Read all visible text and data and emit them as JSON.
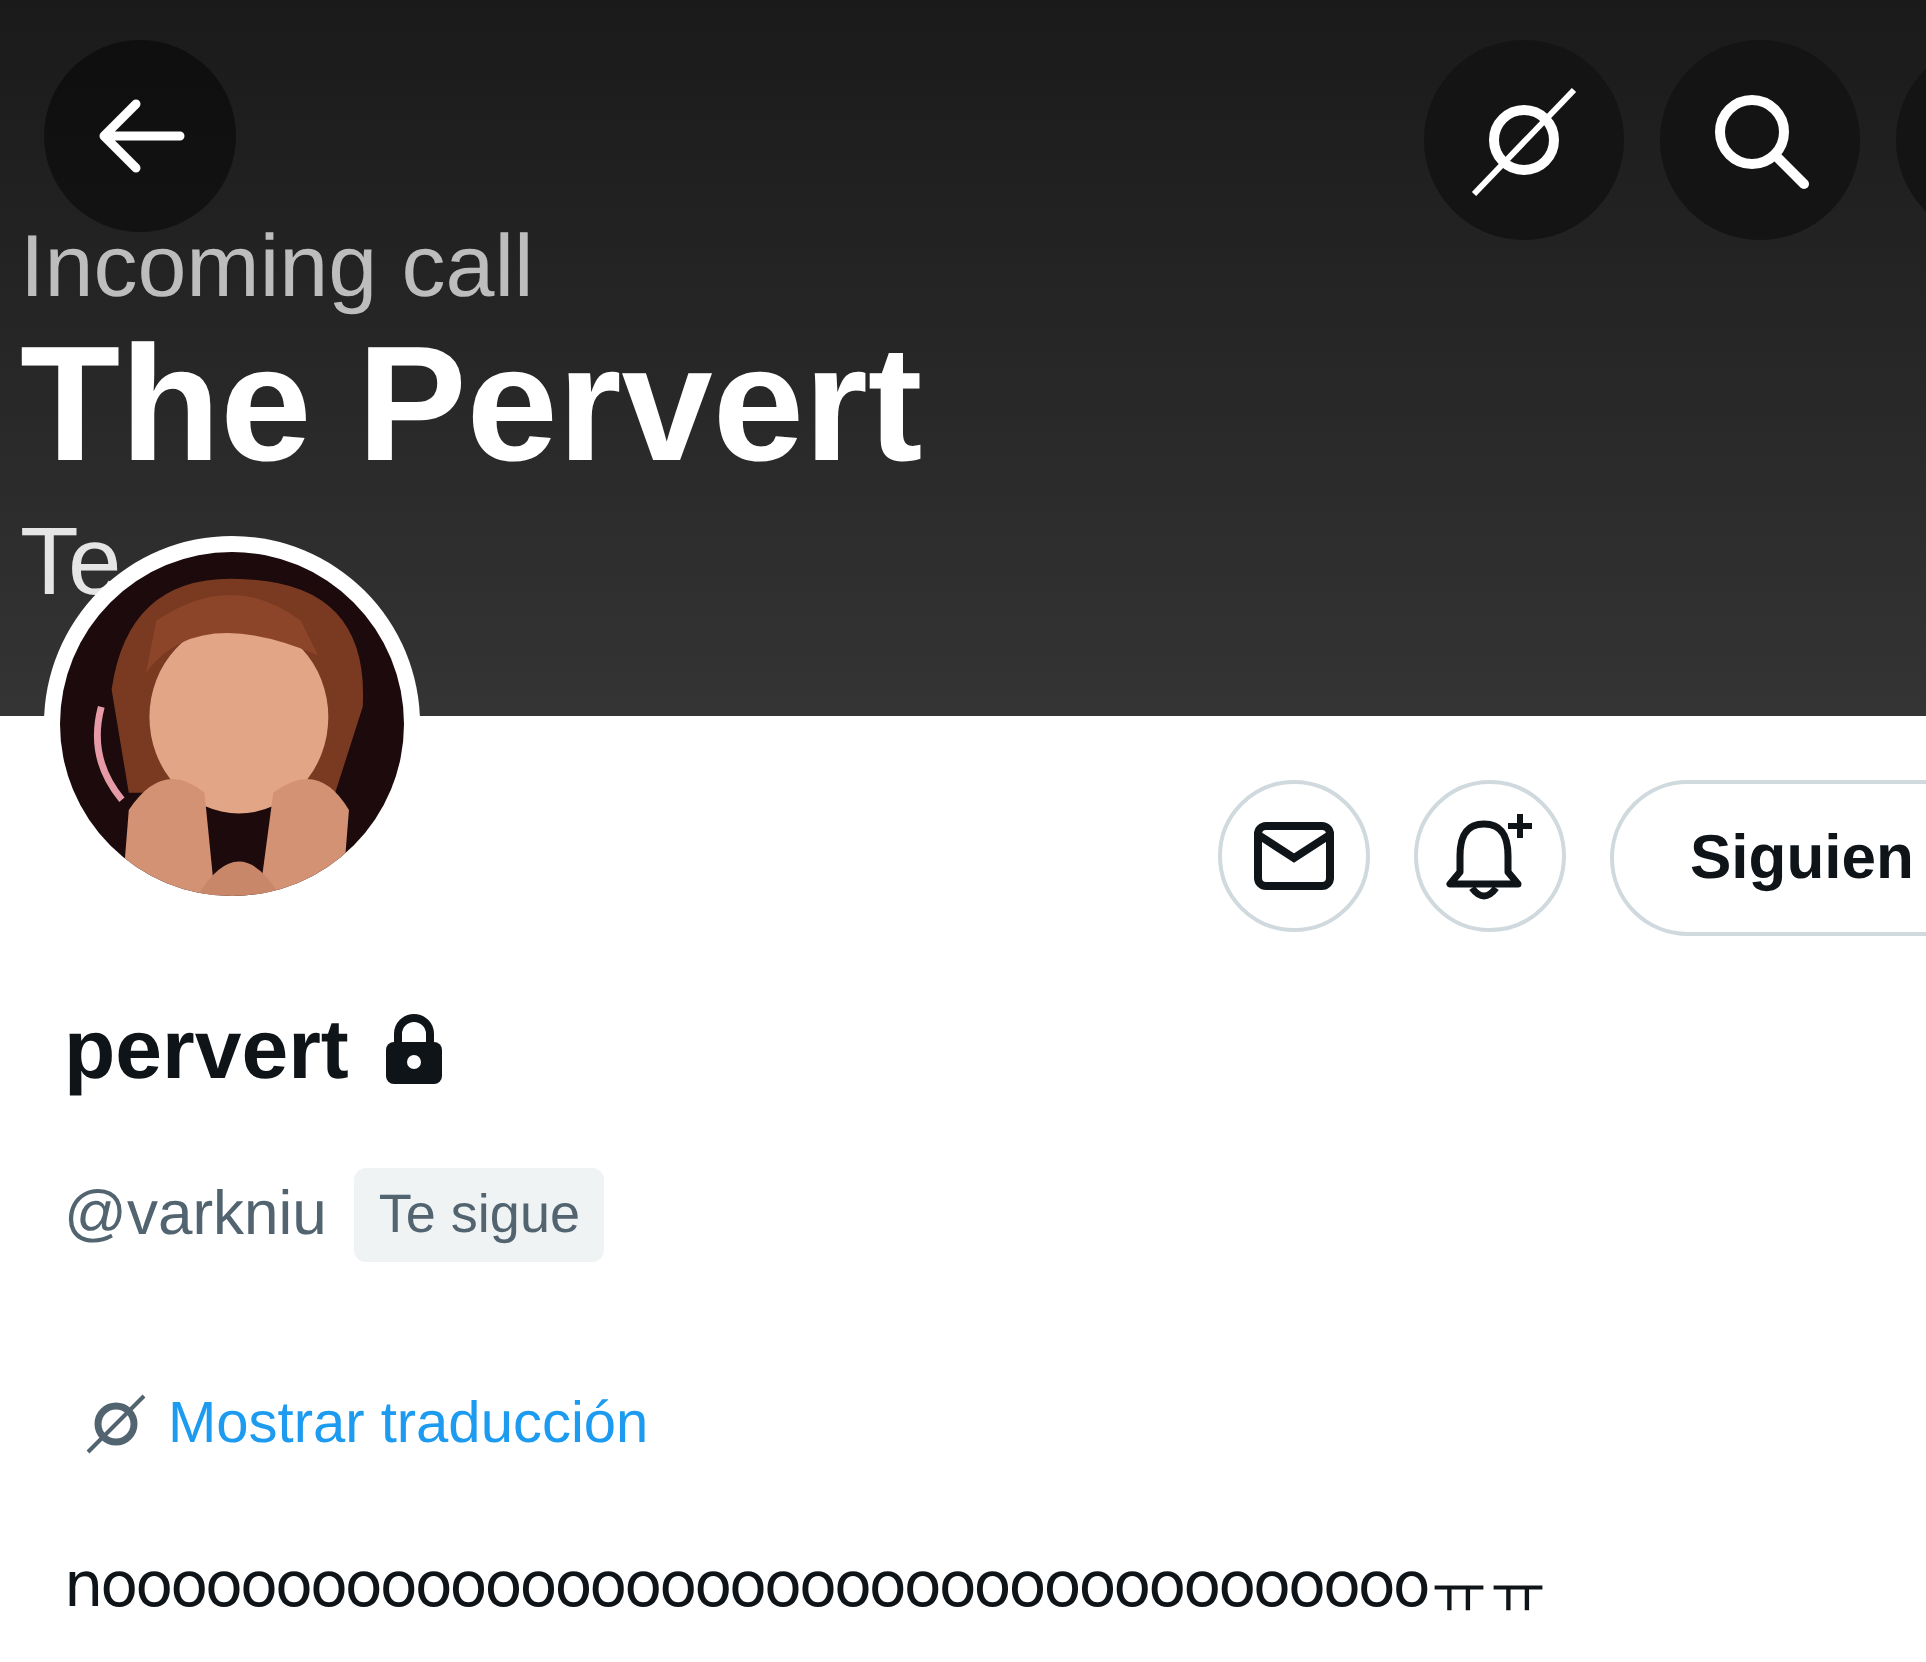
{
  "banner": {
    "texts": [
      "Incoming call",
      "The Pervert",
      "Te"
    ]
  },
  "profile": {
    "name": "pervert",
    "locked": true,
    "handle": "@varkniu",
    "follows_you_badge": "Te sigue",
    "translate_link": "Mostrar traducción",
    "bio": "nooooooooooooooooooooooooooooooooooooooㅠㅠ"
  },
  "actions": {
    "follow_button": "Siguien"
  }
}
